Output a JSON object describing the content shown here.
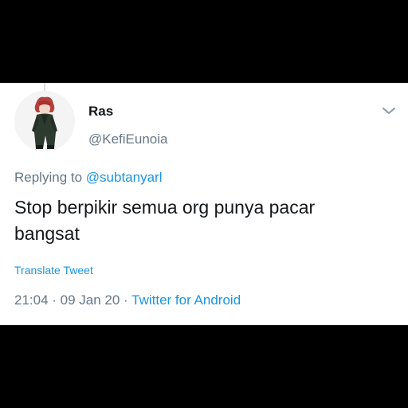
{
  "tweet": {
    "display_name": "Ras",
    "handle": "@KefiEunoia",
    "reply_prefix": "Replying to",
    "reply_mention": "@subtanyarl",
    "text_line1": "Stop berpikir semua org punya pacar",
    "text_line2": "bangsat",
    "translate_label": "Translate Tweet",
    "timestamp": "21:04 · 09 Jan 20 ·",
    "source": "Twitter for Android"
  },
  "icons": {
    "menu": "chevron-down-icon",
    "avatar": "avatar-image"
  },
  "colors": {
    "card_bg": "#ffffff",
    "outer_bg": "#000000",
    "primary_text": "#14171a",
    "secondary_text": "#657786",
    "link": "#1b95e0"
  }
}
